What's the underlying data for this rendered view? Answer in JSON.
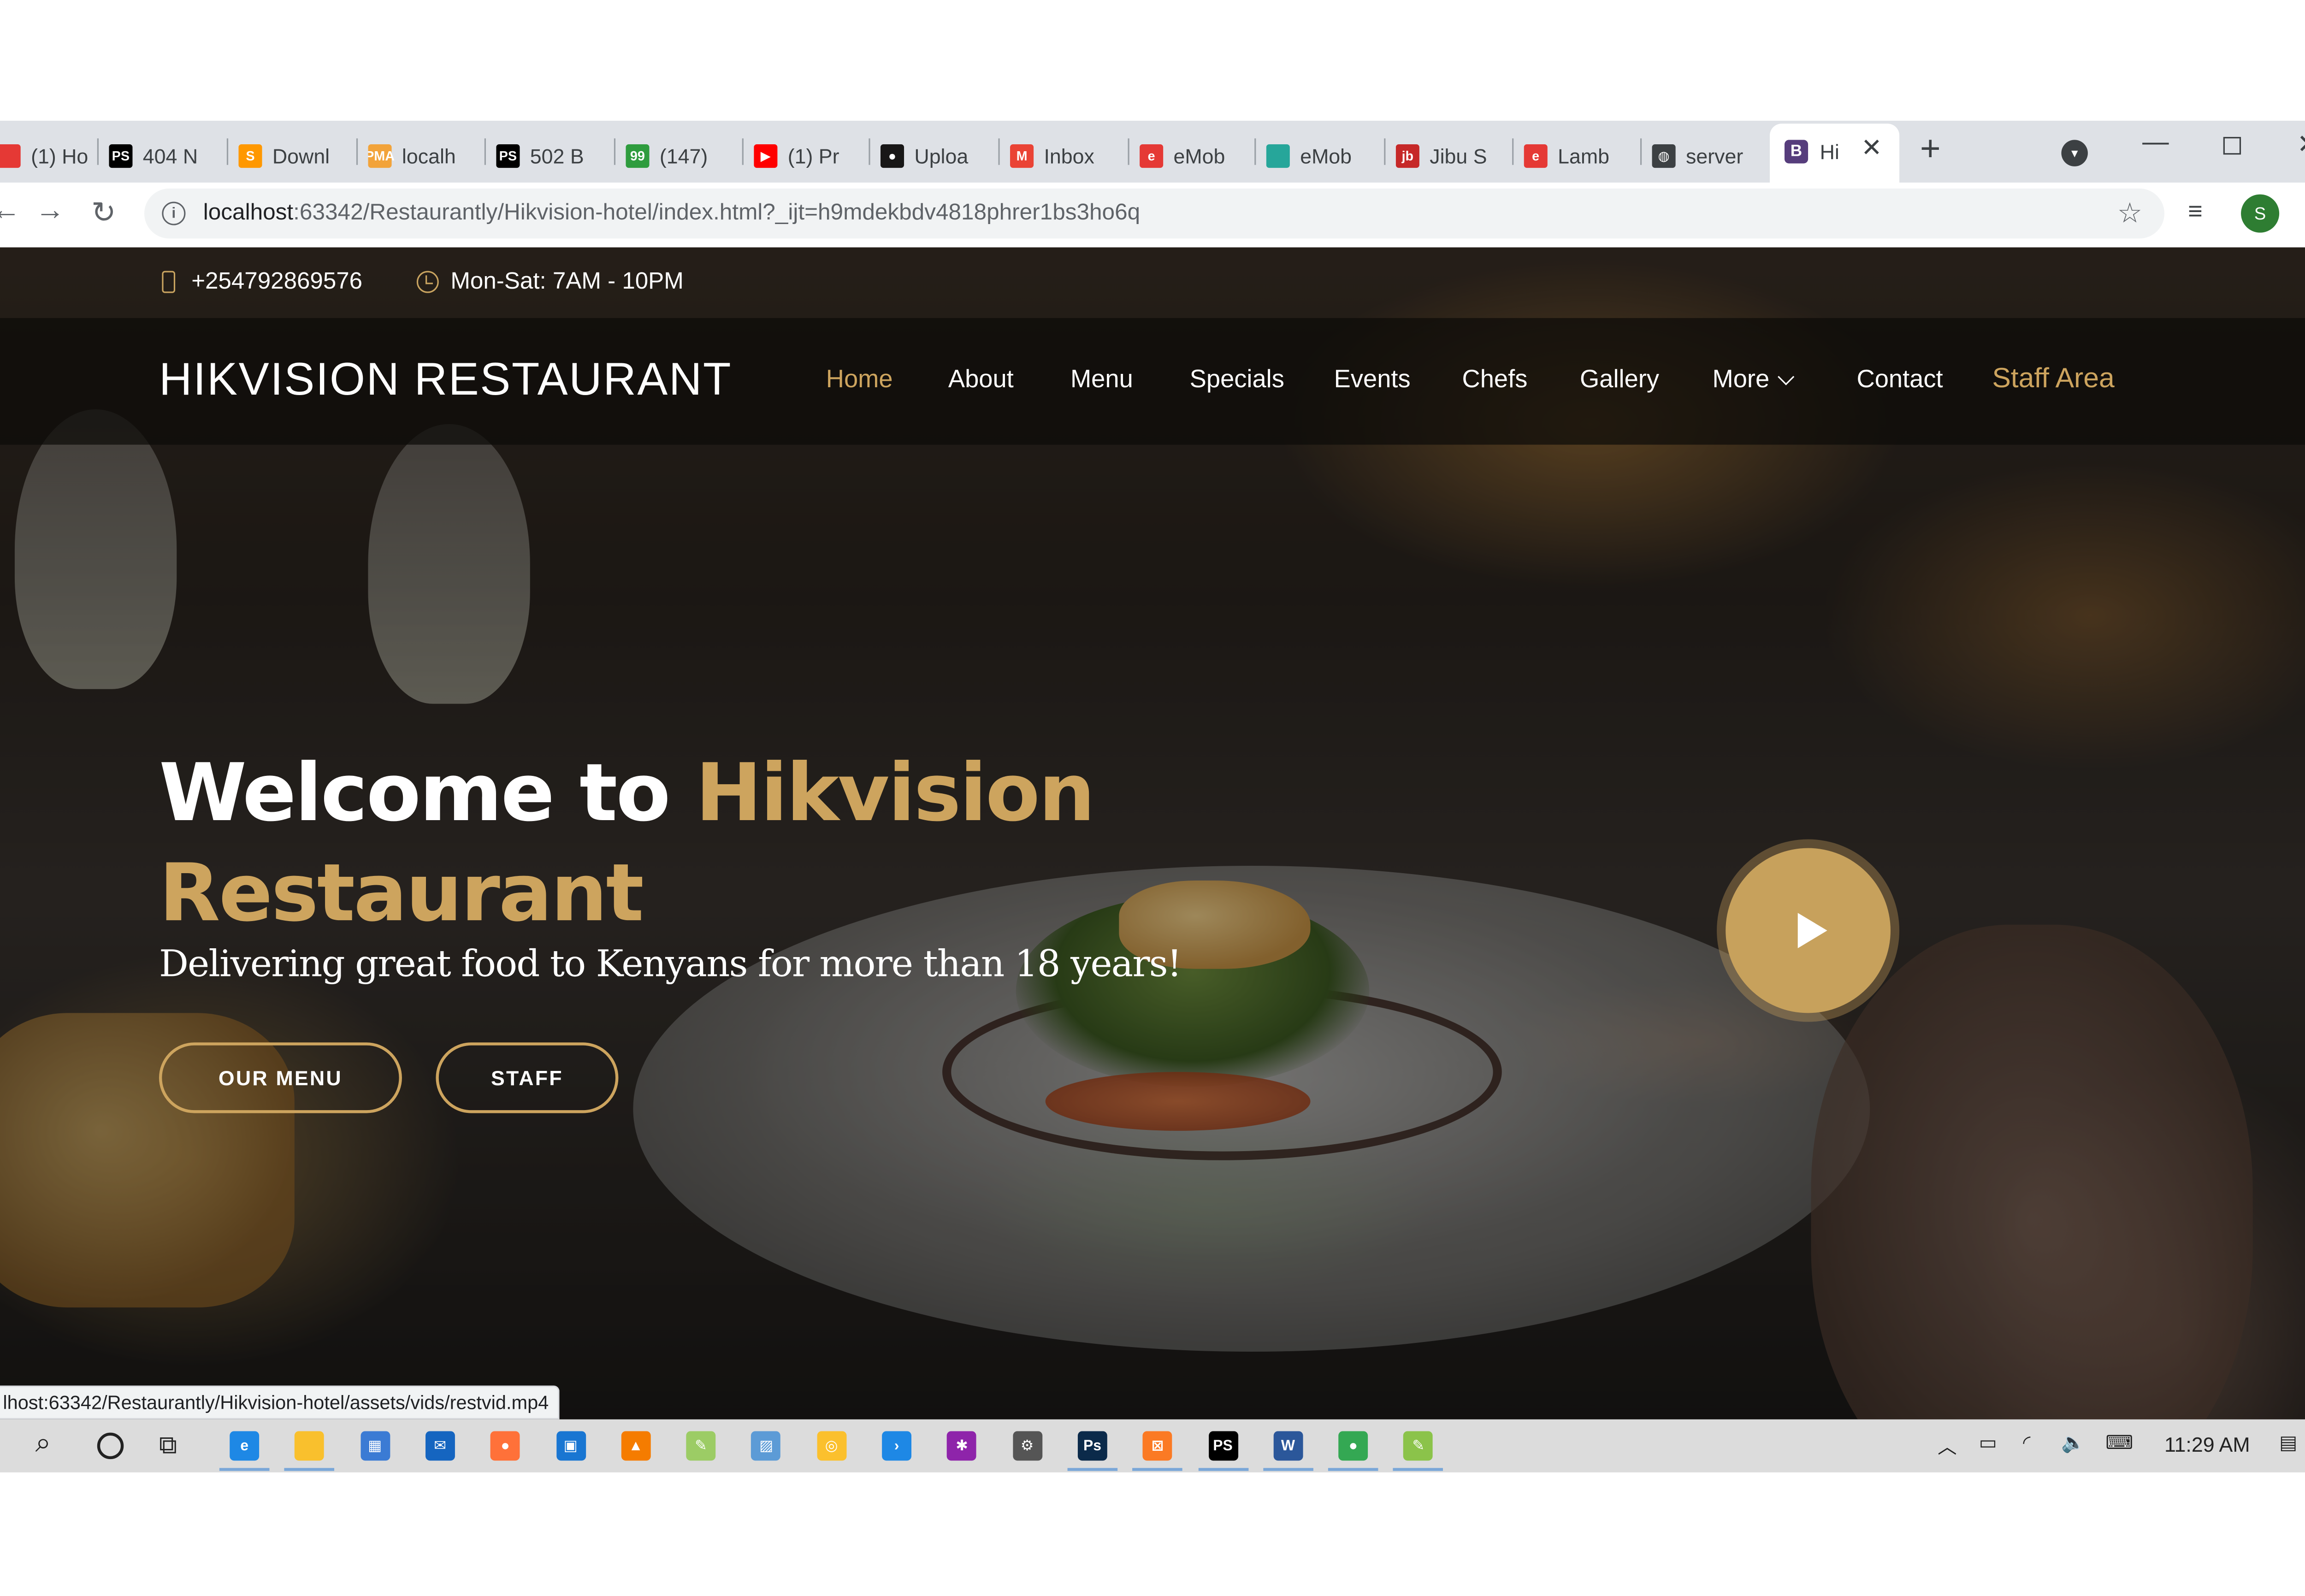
{
  "browser": {
    "tabs": [
      {
        "title": "(1) Ho",
        "icon": "red-app-icon",
        "color": "#e53935",
        "glyph": ""
      },
      {
        "title": "404 N",
        "icon": "phpstorm-icon",
        "color": "#000000",
        "glyph": "PS"
      },
      {
        "title": "Downl",
        "icon": "sublime-icon",
        "color": "#ff9800",
        "glyph": "S"
      },
      {
        "title": "localh",
        "icon": "phpmyadmin-icon",
        "color": "#f2a33a",
        "glyph": "PMA"
      },
      {
        "title": "502 B",
        "icon": "phpstorm-icon",
        "color": "#000000",
        "glyph": "PS"
      },
      {
        "title": "(147)",
        "icon": "green-chat-icon",
        "color": "#2e9c3e",
        "glyph": "99"
      },
      {
        "title": "(1) Pr",
        "icon": "youtube-icon",
        "color": "#ff0000",
        "glyph": "▶"
      },
      {
        "title": "Uploa",
        "icon": "github-icon",
        "color": "#181717",
        "glyph": "●"
      },
      {
        "title": "Inbox",
        "icon": "gmail-icon",
        "color": "#ea4335",
        "glyph": "M"
      },
      {
        "title": "eMob",
        "icon": "e-app-icon",
        "color": "#e53935",
        "glyph": "e"
      },
      {
        "title": "eMob",
        "icon": "teal-app-icon",
        "color": "#26a69a",
        "glyph": ""
      },
      {
        "title": "Jibu S",
        "icon": "jibu-icon",
        "color": "#c62828",
        "glyph": "jb"
      },
      {
        "title": "Lamb",
        "icon": "e-app-icon",
        "color": "#e53935",
        "glyph": "e"
      },
      {
        "title": "server",
        "icon": "globe-icon",
        "color": "#3c4043",
        "glyph": "◍"
      }
    ],
    "active_tab": {
      "title": "Hi",
      "icon": "bootstrap-icon",
      "glyph": "B",
      "close": "✕"
    },
    "new_tab": "+",
    "url_host": "localhost",
    "url_rest": ":63342/Restaurantly/Hikvision-hotel/index.html?_ijt=h9mdekbdv4818phrer1bs3ho6q",
    "avatar_letter": "S",
    "status_link": "lhost:63342/Restaurantly/Hikvision-hotel/assets/vids/restvid.mp4"
  },
  "site": {
    "phone": "+254792869576",
    "hours": "Mon-Sat: 7AM - 10PM",
    "logo": "HIKVISION RESTAURANT",
    "nav": {
      "home": "Home",
      "about": "About",
      "menu": "Menu",
      "specials": "Specials",
      "events": "Events",
      "chefs": "Chefs",
      "gallery": "Gallery",
      "more": "More",
      "contact": "Contact",
      "staff_area": "Staff Area"
    },
    "hero": {
      "title_white": "Welcome to ",
      "title_gold": "Hikvision Restaurant",
      "subtitle": "Delivering great food to Kenyans for more than 18 years!",
      "btn_menu": "OUR MENU",
      "btn_staff": "STAFF"
    },
    "accent_color": "#cda45e"
  },
  "taskbar": {
    "apps": [
      {
        "icon": "edge-icon",
        "color": "#1e88e5",
        "glyph": "e"
      },
      {
        "icon": "file-explorer-icon",
        "color": "#f9c02d",
        "glyph": ""
      },
      {
        "icon": "store-icon",
        "color": "#3b7bd4",
        "glyph": "▦"
      },
      {
        "icon": "mail-icon",
        "color": "#1565c0",
        "glyph": "✉"
      },
      {
        "icon": "firefox-icon",
        "color": "#ff7139",
        "glyph": "●"
      },
      {
        "icon": "remote-desktop-icon",
        "color": "#1976d2",
        "glyph": "▣"
      },
      {
        "icon": "vlc-icon",
        "color": "#f57c00",
        "glyph": "▲"
      },
      {
        "icon": "notepad-icon",
        "color": "#9ccc65",
        "glyph": "✎"
      },
      {
        "icon": "photos-icon",
        "color": "#5c9bd6",
        "glyph": "▨"
      },
      {
        "icon": "app-circle-icon",
        "color": "#fbc02d",
        "glyph": "◎"
      },
      {
        "icon": "powershell-icon",
        "color": "#1e88e5",
        "glyph": "›"
      },
      {
        "icon": "pinwheel-icon",
        "color": "#8e24aa",
        "glyph": "✱"
      },
      {
        "icon": "settings-icon",
        "color": "#555555",
        "glyph": "⚙"
      },
      {
        "icon": "photoshop-icon",
        "color": "#0b2a4a",
        "glyph": "Ps"
      },
      {
        "icon": "xampp-icon",
        "color": "#fb7a24",
        "glyph": "⊠"
      },
      {
        "icon": "phpstorm-icon",
        "color": "#000000",
        "glyph": "PS"
      },
      {
        "icon": "word-icon",
        "color": "#2b579a",
        "glyph": "W"
      },
      {
        "icon": "chrome-icon",
        "color": "#34a853",
        "glyph": "●"
      },
      {
        "icon": "notepadpp-icon",
        "color": "#8bc34a",
        "glyph": "✎"
      }
    ],
    "clock": "11:29 AM"
  }
}
